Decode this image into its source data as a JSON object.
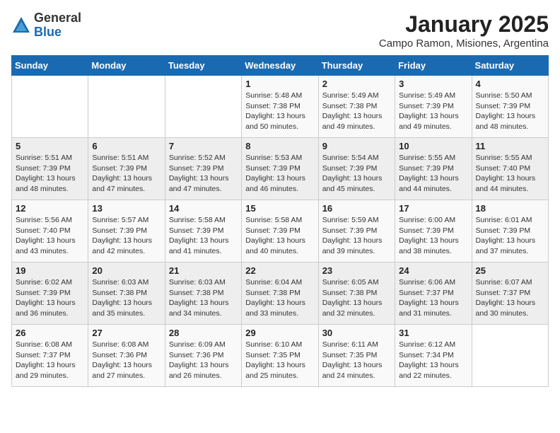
{
  "header": {
    "logo_general": "General",
    "logo_blue": "Blue",
    "title": "January 2025",
    "subtitle": "Campo Ramon, Misiones, Argentina"
  },
  "days_of_week": [
    "Sunday",
    "Monday",
    "Tuesday",
    "Wednesday",
    "Thursday",
    "Friday",
    "Saturday"
  ],
  "weeks": [
    [
      {
        "day": "",
        "info": ""
      },
      {
        "day": "",
        "info": ""
      },
      {
        "day": "",
        "info": ""
      },
      {
        "day": "1",
        "info": "Sunrise: 5:48 AM\nSunset: 7:38 PM\nDaylight: 13 hours\nand 50 minutes."
      },
      {
        "day": "2",
        "info": "Sunrise: 5:49 AM\nSunset: 7:38 PM\nDaylight: 13 hours\nand 49 minutes."
      },
      {
        "day": "3",
        "info": "Sunrise: 5:49 AM\nSunset: 7:39 PM\nDaylight: 13 hours\nand 49 minutes."
      },
      {
        "day": "4",
        "info": "Sunrise: 5:50 AM\nSunset: 7:39 PM\nDaylight: 13 hours\nand 48 minutes."
      }
    ],
    [
      {
        "day": "5",
        "info": "Sunrise: 5:51 AM\nSunset: 7:39 PM\nDaylight: 13 hours\nand 48 minutes."
      },
      {
        "day": "6",
        "info": "Sunrise: 5:51 AM\nSunset: 7:39 PM\nDaylight: 13 hours\nand 47 minutes."
      },
      {
        "day": "7",
        "info": "Sunrise: 5:52 AM\nSunset: 7:39 PM\nDaylight: 13 hours\nand 47 minutes."
      },
      {
        "day": "8",
        "info": "Sunrise: 5:53 AM\nSunset: 7:39 PM\nDaylight: 13 hours\nand 46 minutes."
      },
      {
        "day": "9",
        "info": "Sunrise: 5:54 AM\nSunset: 7:39 PM\nDaylight: 13 hours\nand 45 minutes."
      },
      {
        "day": "10",
        "info": "Sunrise: 5:55 AM\nSunset: 7:39 PM\nDaylight: 13 hours\nand 44 minutes."
      },
      {
        "day": "11",
        "info": "Sunrise: 5:55 AM\nSunset: 7:40 PM\nDaylight: 13 hours\nand 44 minutes."
      }
    ],
    [
      {
        "day": "12",
        "info": "Sunrise: 5:56 AM\nSunset: 7:40 PM\nDaylight: 13 hours\nand 43 minutes."
      },
      {
        "day": "13",
        "info": "Sunrise: 5:57 AM\nSunset: 7:39 PM\nDaylight: 13 hours\nand 42 minutes."
      },
      {
        "day": "14",
        "info": "Sunrise: 5:58 AM\nSunset: 7:39 PM\nDaylight: 13 hours\nand 41 minutes."
      },
      {
        "day": "15",
        "info": "Sunrise: 5:58 AM\nSunset: 7:39 PM\nDaylight: 13 hours\nand 40 minutes."
      },
      {
        "day": "16",
        "info": "Sunrise: 5:59 AM\nSunset: 7:39 PM\nDaylight: 13 hours\nand 39 minutes."
      },
      {
        "day": "17",
        "info": "Sunrise: 6:00 AM\nSunset: 7:39 PM\nDaylight: 13 hours\nand 38 minutes."
      },
      {
        "day": "18",
        "info": "Sunrise: 6:01 AM\nSunset: 7:39 PM\nDaylight: 13 hours\nand 37 minutes."
      }
    ],
    [
      {
        "day": "19",
        "info": "Sunrise: 6:02 AM\nSunset: 7:39 PM\nDaylight: 13 hours\nand 36 minutes."
      },
      {
        "day": "20",
        "info": "Sunrise: 6:03 AM\nSunset: 7:38 PM\nDaylight: 13 hours\nand 35 minutes."
      },
      {
        "day": "21",
        "info": "Sunrise: 6:03 AM\nSunset: 7:38 PM\nDaylight: 13 hours\nand 34 minutes."
      },
      {
        "day": "22",
        "info": "Sunrise: 6:04 AM\nSunset: 7:38 PM\nDaylight: 13 hours\nand 33 minutes."
      },
      {
        "day": "23",
        "info": "Sunrise: 6:05 AM\nSunset: 7:38 PM\nDaylight: 13 hours\nand 32 minutes."
      },
      {
        "day": "24",
        "info": "Sunrise: 6:06 AM\nSunset: 7:37 PM\nDaylight: 13 hours\nand 31 minutes."
      },
      {
        "day": "25",
        "info": "Sunrise: 6:07 AM\nSunset: 7:37 PM\nDaylight: 13 hours\nand 30 minutes."
      }
    ],
    [
      {
        "day": "26",
        "info": "Sunrise: 6:08 AM\nSunset: 7:37 PM\nDaylight: 13 hours\nand 29 minutes."
      },
      {
        "day": "27",
        "info": "Sunrise: 6:08 AM\nSunset: 7:36 PM\nDaylight: 13 hours\nand 27 minutes."
      },
      {
        "day": "28",
        "info": "Sunrise: 6:09 AM\nSunset: 7:36 PM\nDaylight: 13 hours\nand 26 minutes."
      },
      {
        "day": "29",
        "info": "Sunrise: 6:10 AM\nSunset: 7:35 PM\nDaylight: 13 hours\nand 25 minutes."
      },
      {
        "day": "30",
        "info": "Sunrise: 6:11 AM\nSunset: 7:35 PM\nDaylight: 13 hours\nand 24 minutes."
      },
      {
        "day": "31",
        "info": "Sunrise: 6:12 AM\nSunset: 7:34 PM\nDaylight: 13 hours\nand 22 minutes."
      },
      {
        "day": "",
        "info": ""
      }
    ]
  ]
}
